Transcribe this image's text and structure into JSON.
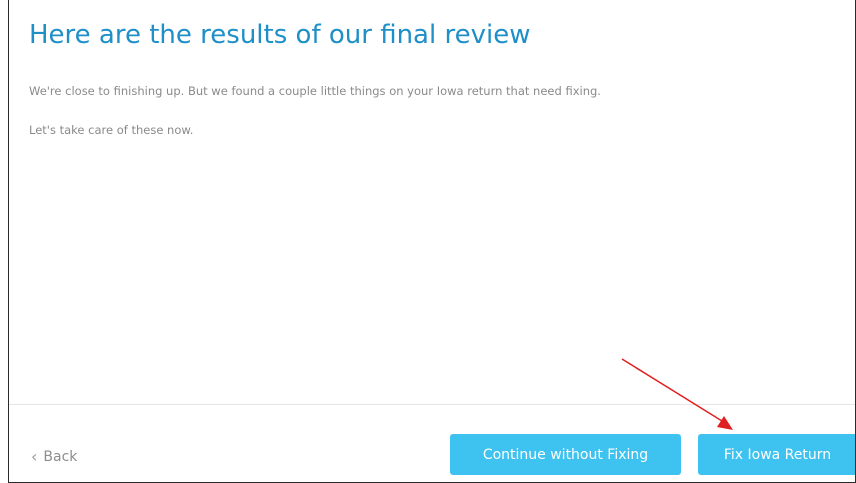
{
  "main": {
    "title": "Here are the results of our final review",
    "paragraph_1": "We're close to finishing up. But we found a couple little things on your Iowa return that need fixing.",
    "paragraph_2": "Let's take care of these now."
  },
  "footer": {
    "back_icon": "chevron-left-icon",
    "back_label": "Back",
    "continue_label": "Continue without Fixing",
    "fix_label": "Fix Iowa Return"
  },
  "colors": {
    "title": "#1f8fc8",
    "button": "#3ec2f0",
    "annotation_arrow": "#e02020"
  }
}
